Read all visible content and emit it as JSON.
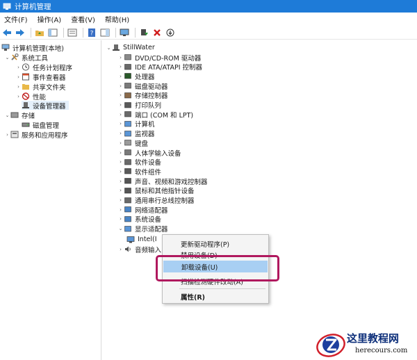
{
  "window": {
    "title": "计算机管理"
  },
  "menu": [
    "文件(F)",
    "操作(A)",
    "查看(V)",
    "帮助(H)"
  ],
  "left_tree": {
    "root": "计算机管理(本地)",
    "system_tools": "系统工具",
    "task_scheduler": "任务计划程序",
    "event_viewer": "事件查看器",
    "shared_folders": "共享文件夹",
    "performance": "性能",
    "device_manager": "设备管理器",
    "storage": "存储",
    "disk_management": "磁盘管理",
    "services": "服务和应用程序"
  },
  "device_tree": {
    "computer": "StillWater",
    "categories": [
      "DVD/CD-ROM 驱动器",
      "IDE ATA/ATAPI 控制器",
      "处理器",
      "磁盘驱动器",
      "存储控制器",
      "打印队列",
      "端口 (COM 和 LPT)",
      "计算机",
      "监视器",
      "键盘",
      "人体学输入设备",
      "软件设备",
      "软件组件",
      "声音、视频和游戏控制器",
      "鼠标和其他指针设备",
      "通用串行总线控制器",
      "网络适配器",
      "系统设备",
      "显示适配器"
    ],
    "display_child": "Intel(I",
    "audio_io": "音频输入"
  },
  "context_menu": {
    "update_driver": "更新驱动程序(P)",
    "disable_device": "禁用设备(D)",
    "uninstall_device": "卸载设备(U)",
    "scan_hardware": "扫描检测硬件改动(A)",
    "properties": "属性(R)"
  },
  "watermark": {
    "title": "这里教程网",
    "site": "herecours.com"
  }
}
